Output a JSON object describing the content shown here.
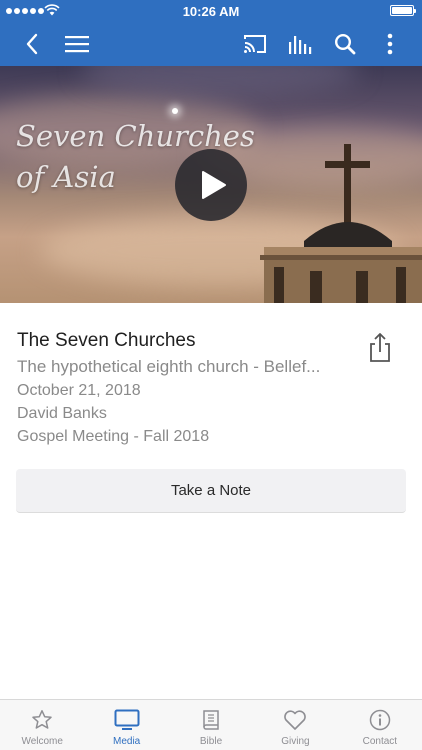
{
  "status_bar": {
    "time": "10:26 AM"
  },
  "app_bar": {
    "icons": [
      "back-icon",
      "menu-icon",
      "cast-icon",
      "equalizer-icon",
      "search-icon",
      "more-icon"
    ]
  },
  "hero": {
    "title_line1": "Seven Churches",
    "title_line2": "of Asia",
    "icon": "play-icon"
  },
  "sermon": {
    "title": "The Seven Churches",
    "subtitle": "The hypothetical eighth church - Bellef...",
    "date": "October 21, 2018",
    "speaker": "David Banks",
    "series": "Gospel Meeting - Fall 2018",
    "share_icon": "share-icon"
  },
  "actions": {
    "note_label": "Take a Note"
  },
  "tabs": [
    {
      "label": "Welcome",
      "icon": "star-icon",
      "active": false
    },
    {
      "label": "Media",
      "icon": "tv-icon",
      "active": true
    },
    {
      "label": "Bible",
      "icon": "book-icon",
      "active": false
    },
    {
      "label": "Giving",
      "icon": "heart-icon",
      "active": false
    },
    {
      "label": "Contact",
      "icon": "info-icon",
      "active": false
    }
  ],
  "colors": {
    "brand": "#2f6fc0",
    "inactive": "#8e8e93",
    "text_secondary": "#8a8a8a"
  }
}
